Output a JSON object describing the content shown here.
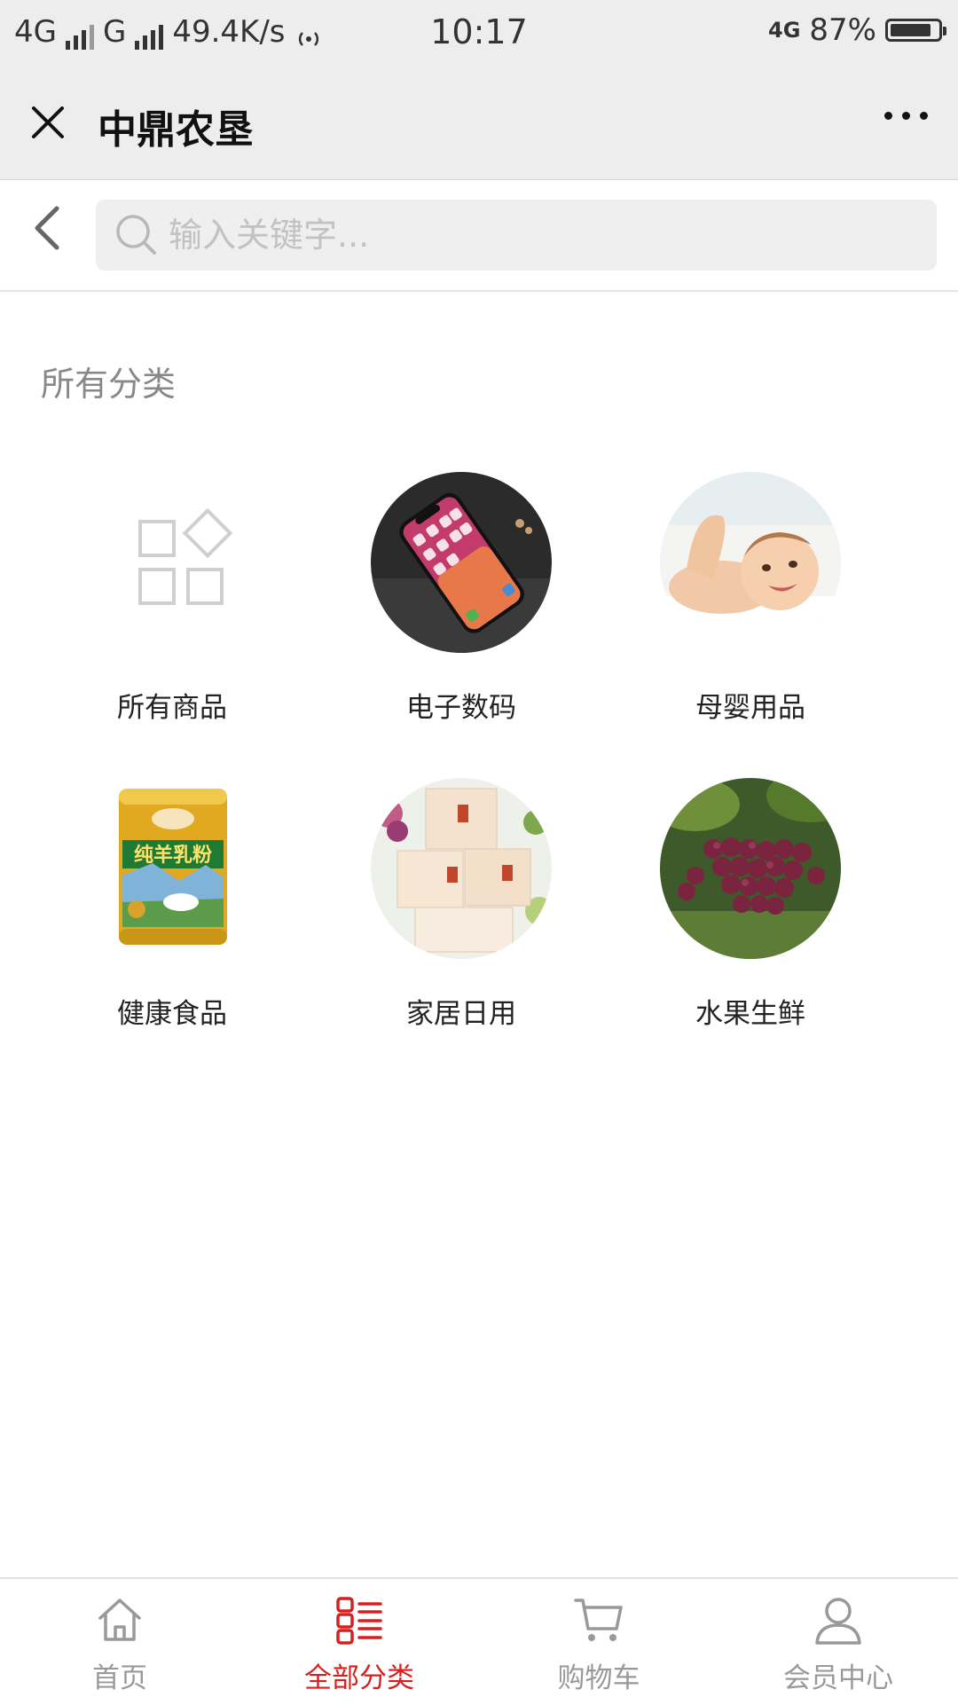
{
  "status_bar": {
    "network1": "4G",
    "network2": "G",
    "speed": "49.4K/s",
    "time": "10:17",
    "network3": "4G",
    "battery": "87%",
    "battery_level": 0.87
  },
  "title_bar": {
    "title": "中鼎农垦"
  },
  "search": {
    "placeholder": "输入关键字..."
  },
  "section_title": "所有分类",
  "categories": [
    {
      "label": "所有商品",
      "image": "grid-icon"
    },
    {
      "label": "电子数码",
      "image": "smartphone-photo"
    },
    {
      "label": "母婴用品",
      "image": "baby-photo"
    },
    {
      "label": "健康食品",
      "image": "milk-powder-can-photo"
    },
    {
      "label": "家居日用",
      "image": "tissue-boxes-photo"
    },
    {
      "label": "水果生鲜",
      "image": "grapes-photo"
    }
  ],
  "tabs": [
    {
      "label": "首页",
      "icon": "home-icon",
      "active": false
    },
    {
      "label": "全部分类",
      "icon": "category-list-icon",
      "active": true
    },
    {
      "label": "购物车",
      "icon": "cart-icon",
      "active": false
    },
    {
      "label": "会员中心",
      "icon": "user-icon",
      "active": false
    }
  ],
  "colors": {
    "accent": "#d81e1e",
    "tab_inactive": "#999999",
    "header_bg": "#ededed"
  }
}
